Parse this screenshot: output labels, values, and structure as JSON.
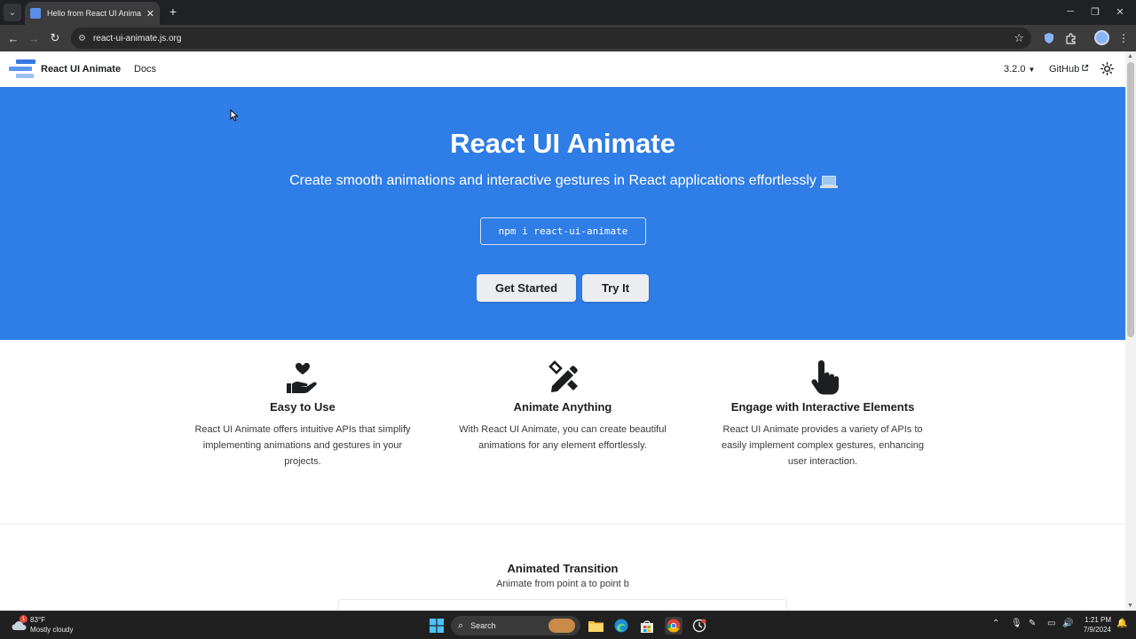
{
  "browser": {
    "tab_title": "Hello from React UI Animate | R",
    "url": "react-ui-animate.js.org"
  },
  "site_nav": {
    "brand": "React UI Animate",
    "docs": "Docs",
    "version": "3.2.0",
    "github": "GitHub"
  },
  "hero": {
    "title": "React UI Animate",
    "subtitle": "Create smooth animations and interactive gestures in React applications effortlessly",
    "install_command": "npm i react-ui-animate",
    "get_started": "Get Started",
    "try_it": "Try It",
    "background_color": "#2f7de6"
  },
  "features": [
    {
      "icon": "hand-holding-heart-icon",
      "title": "Easy to Use",
      "description": "React UI Animate offers intuitive APIs that simplify implementing animations and gestures in your projects."
    },
    {
      "icon": "pen-ruler-icon",
      "title": "Animate Anything",
      "description": "With React UI Animate, you can create beautiful animations for any element effortlessly."
    },
    {
      "icon": "hand-pointer-icon",
      "title": "Engage with Interactive Elements",
      "description": "React UI Animate provides a variety of APIs to easily implement complex gestures, enhancing user interaction."
    }
  ],
  "demo": {
    "title": "Animated Transition",
    "subtitle": "Animate from point a to point b"
  },
  "taskbar": {
    "weather_temp": "83°F",
    "weather_desc": "Mostly cloudy",
    "weather_badge": "1",
    "search": "Search",
    "time": "1:21 PM",
    "date": "7/9/2024"
  }
}
